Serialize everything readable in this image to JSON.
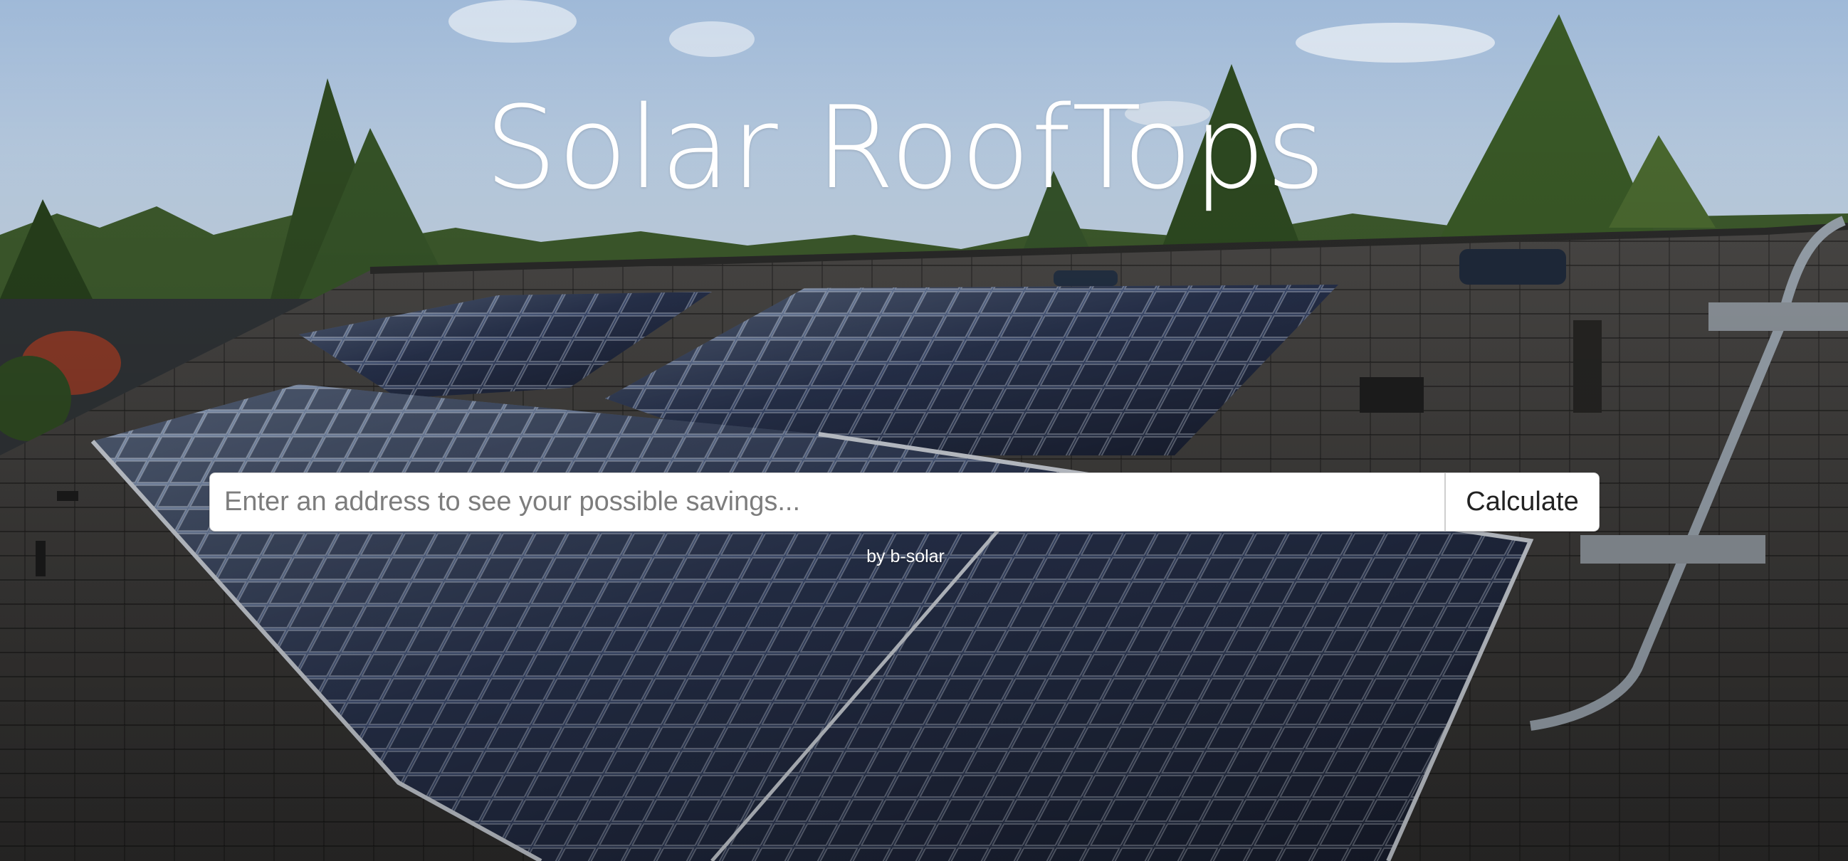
{
  "hero": {
    "title": "Solar RoofTops",
    "byline": "by b-solar"
  },
  "search": {
    "placeholder": "Enter an address to see your possible savings...",
    "value": "",
    "button_label": "Calculate"
  },
  "colors": {
    "title_text": "#ffffff",
    "sky": "#a9c2de",
    "roof": "#3e3d3c",
    "panel": "#2d3a5a"
  }
}
